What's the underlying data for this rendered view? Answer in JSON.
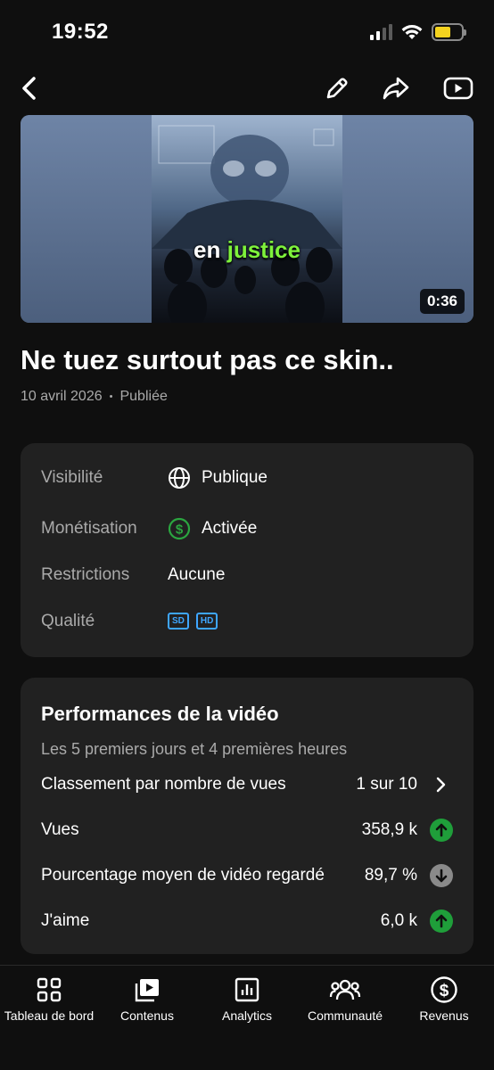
{
  "status": {
    "time": "19:52"
  },
  "video": {
    "caption_word1": "en",
    "caption_word2": "justice",
    "duration": "0:36",
    "title": "Ne tuez surtout pas ce skin..",
    "date": "10 avril 2026",
    "separator": "•",
    "status": "Publiée"
  },
  "details": {
    "visibility_label": "Visibilité",
    "visibility_value": "Publique",
    "monetization_label": "Monétisation",
    "monetization_value": "Activée",
    "restrictions_label": "Restrictions",
    "restrictions_value": "Aucune",
    "quality_label": "Qualité",
    "quality_badges": [
      "SD",
      "HD"
    ]
  },
  "performance": {
    "title": "Performances de la vidéo",
    "subtitle": "Les 5 premiers jours et 4 premières heures",
    "rows": [
      {
        "label": "Classement par nombre de vues",
        "value": "1 sur 10",
        "indicator": "chevron-right"
      },
      {
        "label": "Vues",
        "value": "358,9 k",
        "indicator": "up"
      },
      {
        "label": "Pourcentage moyen de vidéo regardé",
        "value": "89,7 %",
        "indicator": "down"
      },
      {
        "label": "J'aime",
        "value": "6,0 k",
        "indicator": "up"
      }
    ]
  },
  "nav": [
    {
      "label": "Tableau de bord",
      "icon": "dashboard-icon"
    },
    {
      "label": "Contenus",
      "icon": "content-icon"
    },
    {
      "label": "Analytics",
      "icon": "analytics-icon"
    },
    {
      "label": "Communauté",
      "icon": "community-icon"
    },
    {
      "label": "Revenus",
      "icon": "revenue-icon"
    }
  ],
  "colors": {
    "up": "#1f9e3a",
    "down": "#8a8a8a",
    "accent": "#3ea6ff",
    "money": "#2ba640"
  }
}
